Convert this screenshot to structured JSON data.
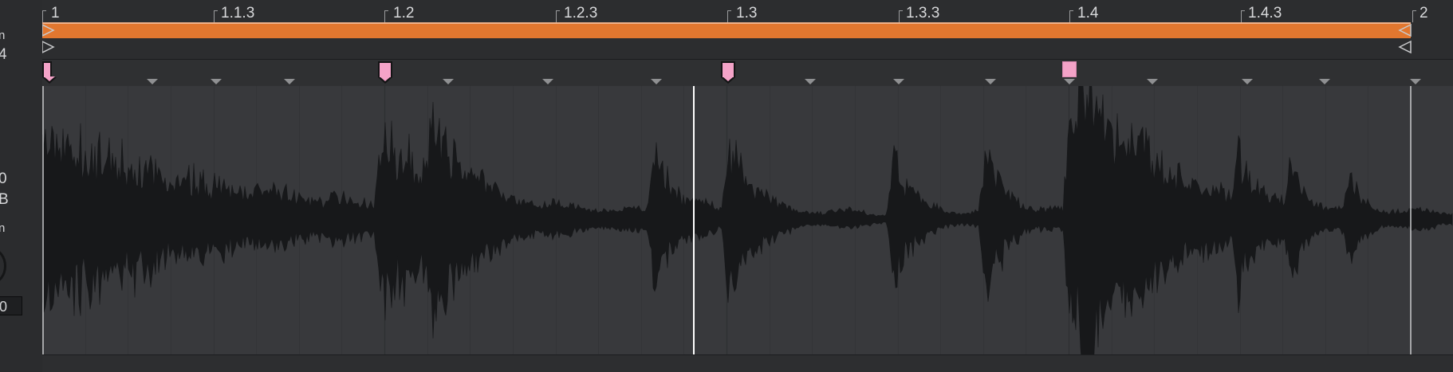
{
  "left_panel": {
    "label_top": "n",
    "label_num": "4",
    "label_zero": "0",
    "label_db": "B",
    "label_n": "n",
    "value_box": "0"
  },
  "ruler": {
    "labels": [
      "1",
      "1.1.3",
      "1.2",
      "1.2.3",
      "1.3",
      "1.3.3",
      "1.4",
      "1.4.3",
      "2"
    ]
  },
  "colors": {
    "loop_bar": "#e2772f",
    "warp_marker": "#f4a3c8",
    "waveform": "#17181a",
    "background": "#38393c"
  },
  "markers": {
    "warp_marker_count": 4,
    "selected_marker_index": 3
  }
}
